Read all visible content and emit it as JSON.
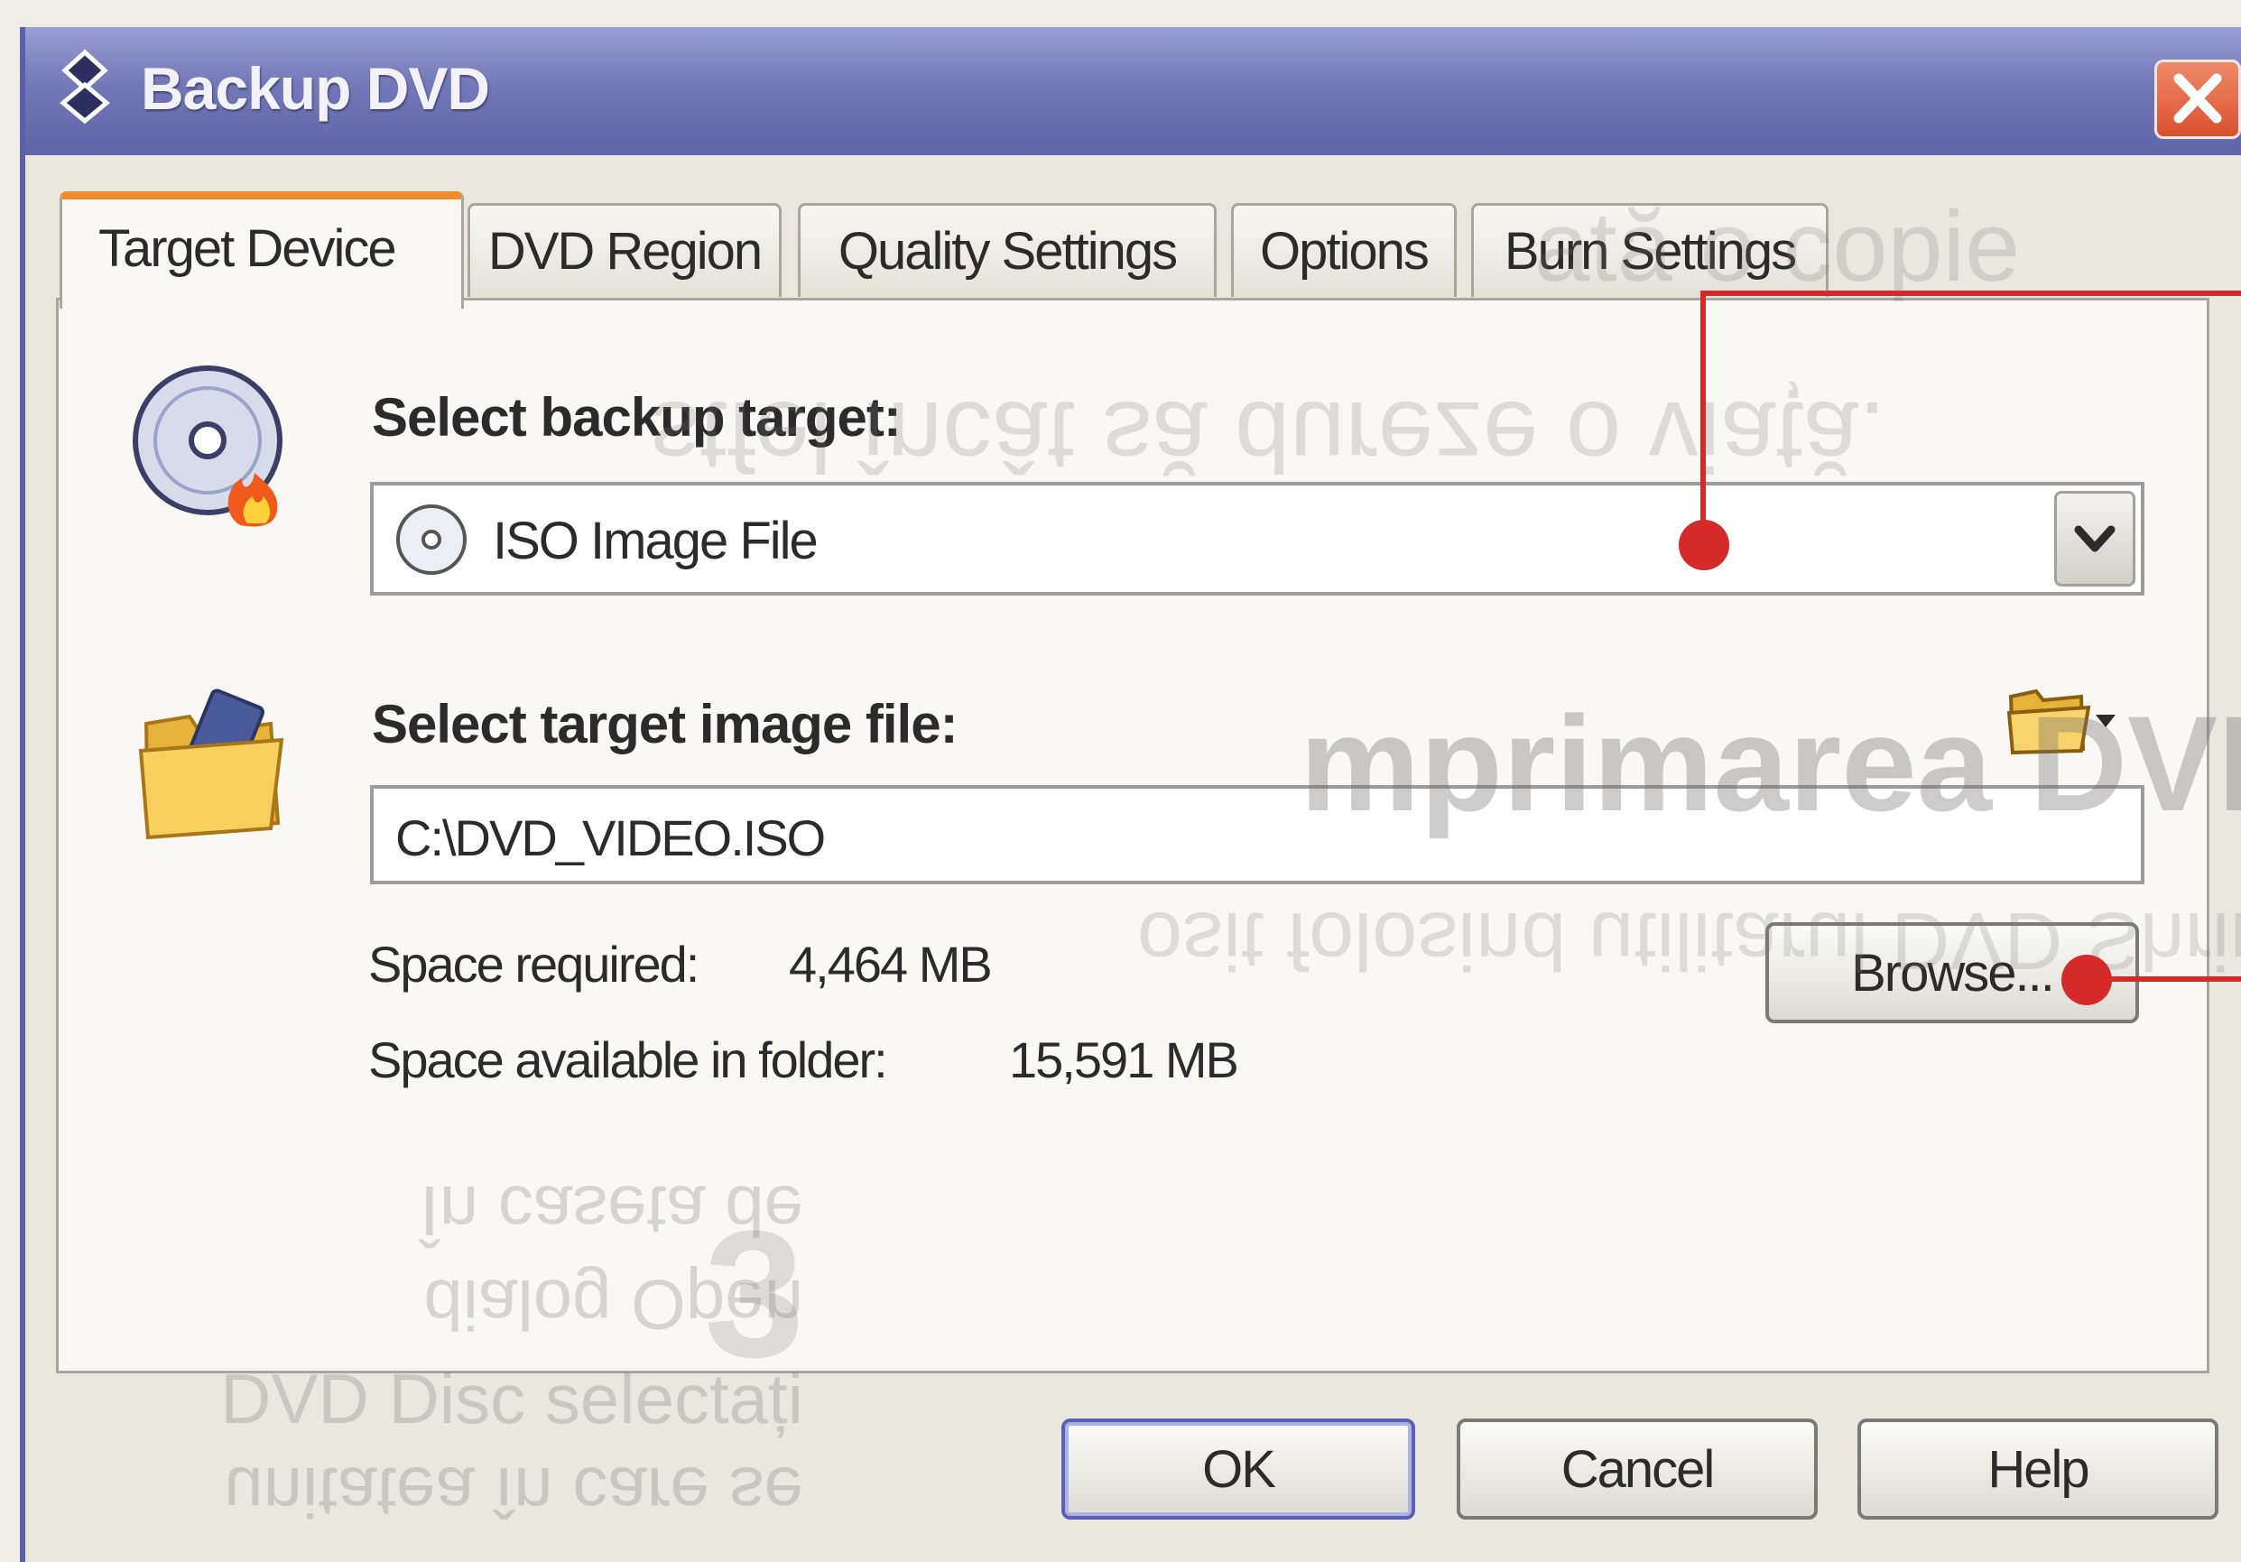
{
  "window": {
    "title": "Backup DVD"
  },
  "tabs": [
    {
      "label": "Target Device",
      "active": true
    },
    {
      "label": "DVD Region"
    },
    {
      "label": "Quality Settings"
    },
    {
      "label": "Options"
    },
    {
      "label": "Burn Settings"
    }
  ],
  "target": {
    "label": "Select backup target:",
    "selected": "ISO Image File"
  },
  "image_file": {
    "label": "Select target image file:",
    "path": "C:\\DVD_VIDEO.ISO"
  },
  "space": {
    "required_label": "Space required:",
    "required_value": "4,464 MB",
    "available_label": "Space available in folder:",
    "available_value": "15,591 MB"
  },
  "buttons": {
    "browse": "Browse...",
    "ok": "OK",
    "cancel": "Cancel",
    "help": "Help"
  },
  "background_print": {
    "line1": "ată o copie",
    "line2": "stfel încât să dureze o viață.",
    "heading": "mprimarea DVD",
    "line3": "osit folosind utilitarul DVD Shrink",
    "step_number": "3",
    "step_lines": [
      "În caseta de",
      "dialog Open",
      "DVD Disc selectați",
      "unitatea în care se"
    ]
  },
  "colors": {
    "titlebar": "#6a6fb0",
    "active_tab_accent": "#f08a2a",
    "callout": "#d52a2a"
  }
}
